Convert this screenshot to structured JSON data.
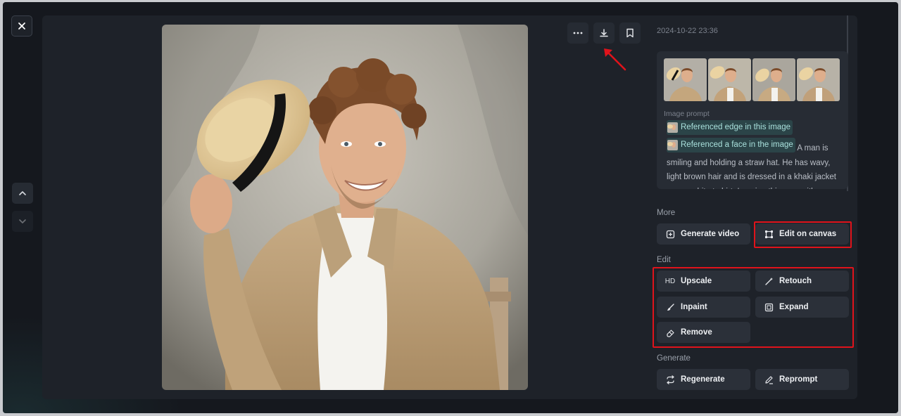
{
  "viewer": {
    "timestamp": "2024-10-22 23:36",
    "prompt_label": "Image prompt",
    "references": [
      {
        "label": "Referenced edge in this image"
      },
      {
        "label": "Referenced a face in the image"
      }
    ],
    "prompt_text": "A man is smiling and holding a straw hat. He has wavy, light brown hair and is dressed in a khaki jacket over a white t-shirt. Imagine this man with a short, neatly trim"
  },
  "sections": {
    "more": {
      "label": "More",
      "buttons": [
        {
          "label": "Generate video",
          "icon": "plus-frame-icon"
        },
        {
          "label": "Edit on canvas",
          "icon": "canvas-icon"
        }
      ]
    },
    "edit": {
      "label": "Edit",
      "buttons": [
        {
          "label": "Upscale",
          "icon": "HD"
        },
        {
          "label": "Retouch",
          "icon": "magic-wand-icon"
        },
        {
          "label": "Inpaint",
          "icon": "brush-icon"
        },
        {
          "label": "Expand",
          "icon": "expand-icon"
        },
        {
          "label": "Remove",
          "icon": "eraser-icon"
        }
      ]
    },
    "generate": {
      "label": "Generate",
      "buttons": [
        {
          "label": "Regenerate",
          "icon": "repeat-icon"
        },
        {
          "label": "Reprompt",
          "icon": "pencil-icon"
        }
      ]
    }
  },
  "colors": {
    "background": "#15181e",
    "panel": "#1e2229",
    "button": "#2b3039",
    "highlight": "#e0131b",
    "reference_chip": "#2b4448"
  }
}
